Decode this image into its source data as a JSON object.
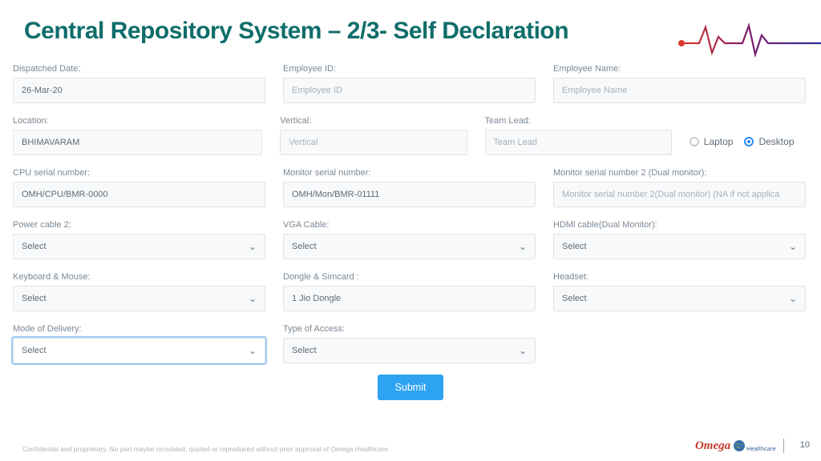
{
  "title": "Central Repository System – 2/3- Self Declaration",
  "fields": {
    "dispatched_date": {
      "label": "Dispatched Date:",
      "value": "26-Mar-20"
    },
    "employee_id": {
      "label": "Employee ID:",
      "placeholder": "Employee ID"
    },
    "employee_name": {
      "label": "Employee Name:",
      "placeholder": "Employee Name"
    },
    "location": {
      "label": "Location:",
      "value": "BHIMAVARAM"
    },
    "vertical": {
      "label": "Vertical:",
      "placeholder": "Vertical"
    },
    "team_lead": {
      "label": "Team Lead:",
      "placeholder": "Team Lead"
    },
    "cpu_serial": {
      "label": "CPU serial number:",
      "value": "OMH/CPU/BMR-0000"
    },
    "monitor_serial": {
      "label": "Monitor serial number:",
      "value": "OMH/Mon/BMR-01111"
    },
    "monitor_serial2": {
      "label": "Monitor serial number 2 (Dual monitor):",
      "placeholder": "Monitor serial number 2(Dual monitor) (NA if not applica"
    },
    "power_cable2": {
      "label": "Power cable 2:",
      "value": "Select"
    },
    "vga_cable": {
      "label": "VGA Cable:",
      "value": "Select"
    },
    "hdmi_cable": {
      "label": "HDMl cable(Dual Monitor):",
      "value": "Select"
    },
    "keyboard_mouse": {
      "label": "Keyboard & Mouse:",
      "value": "Select"
    },
    "dongle_sim": {
      "label": "Dongle & Simcard :",
      "value": "1 Jio Dongle"
    },
    "headset": {
      "label": "Headset:",
      "value": "Select"
    },
    "mode_delivery": {
      "label": "Mode of Delivery:",
      "value": "Select"
    },
    "type_access": {
      "label": "Type of Access:",
      "value": "Select"
    }
  },
  "device_type": {
    "option1": "Laptop",
    "option2": "Desktop",
    "selected": "Desktop"
  },
  "submit_label": "Submit",
  "footer": "Confidential and proprietary. No part maybe circulated, quoted or reproduced without prior approval of Omega Healthcare.",
  "brand": {
    "name": "Omega",
    "sub": "Healthcare"
  },
  "page_number": "10"
}
